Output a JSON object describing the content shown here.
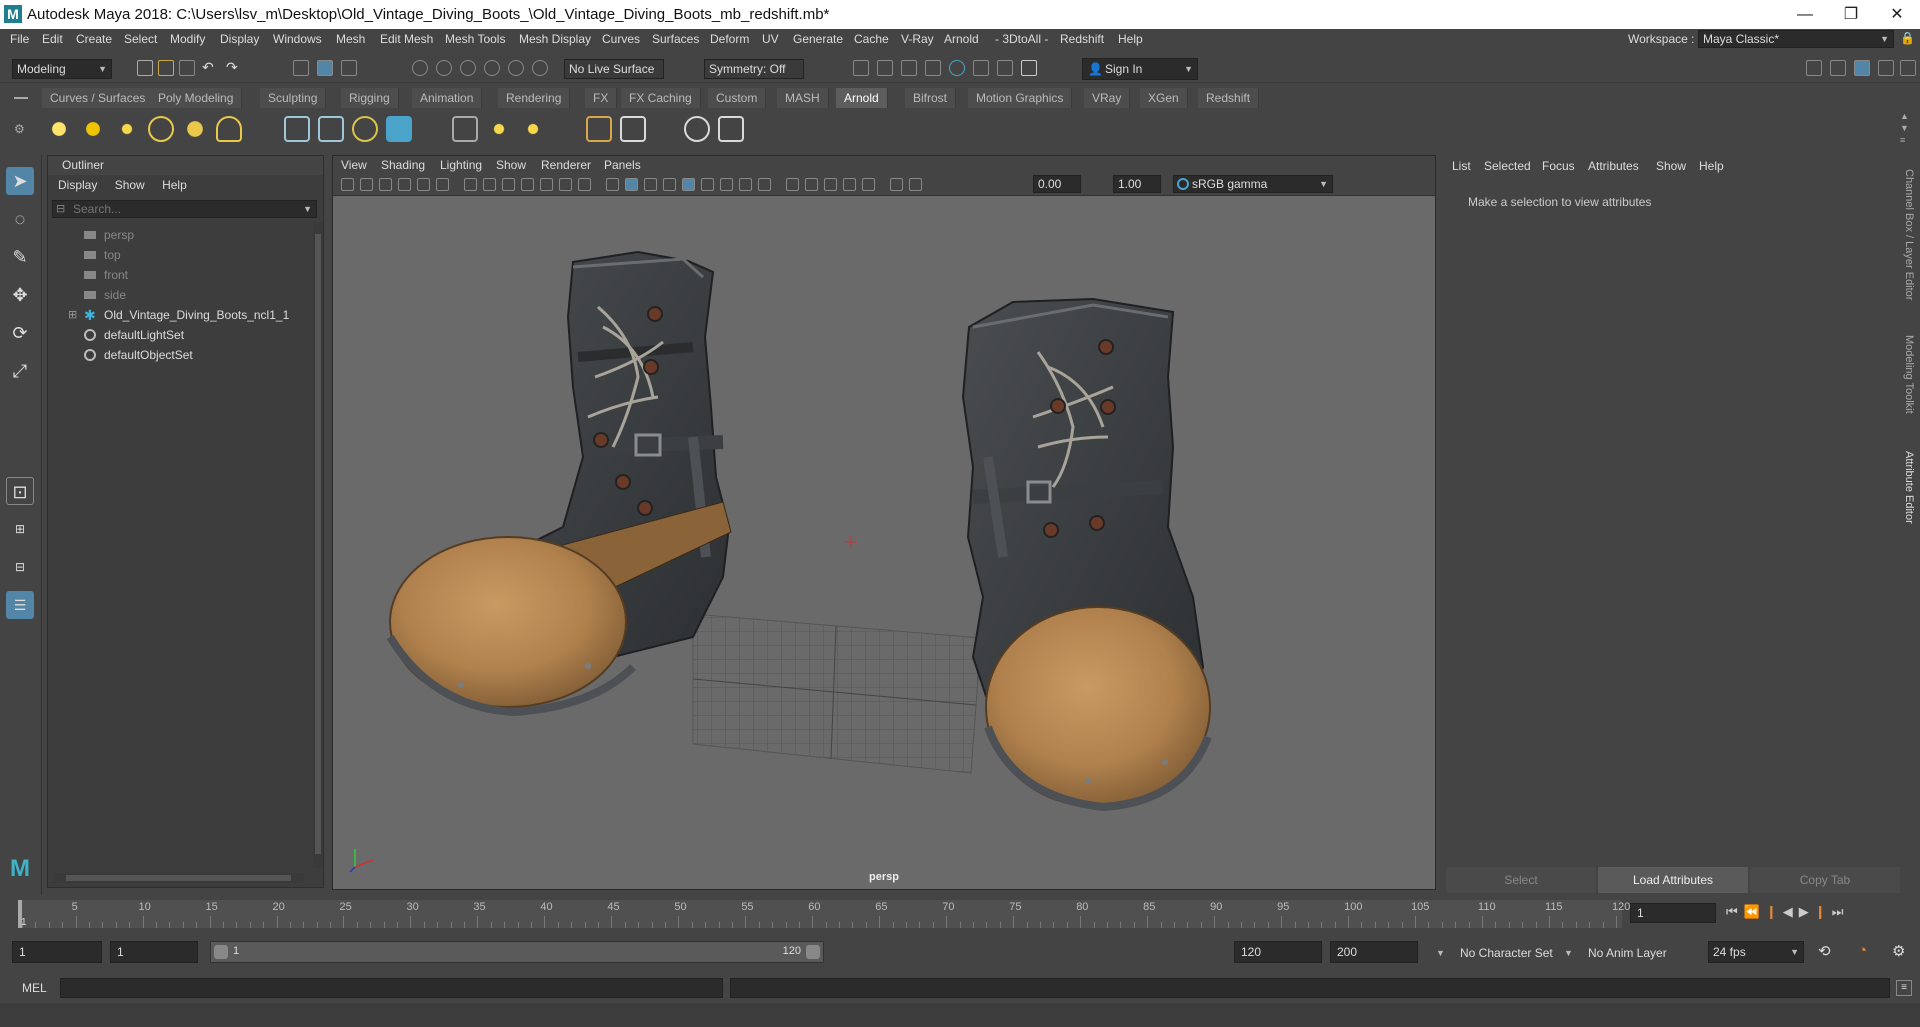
{
  "window": {
    "title": "Autodesk Maya 2018: C:\\Users\\lsv_m\\Desktop\\Old_Vintage_Diving_Boots_\\Old_Vintage_Diving_Boots_mb_redshift.mb*",
    "logo": "M",
    "minimize_icon": "—",
    "maximize_icon": "❐",
    "close_icon": "✕"
  },
  "menubar": [
    "File",
    "Edit",
    "Create",
    "Select",
    "Modify",
    "Display",
    "Windows",
    "Mesh",
    "Edit Mesh",
    "Mesh Tools",
    "Mesh Display",
    "Curves",
    "Surfaces",
    "Deform",
    "UV",
    "Generate",
    "Cache",
    "V-Ray",
    "Arnold",
    "- 3DtoAll -",
    "Redshift",
    "Help"
  ],
  "workspace": {
    "label": "Workspace :",
    "value": "Maya Classic*"
  },
  "statusline": {
    "mode": "Modeling",
    "live_surface": "No Live Surface",
    "symmetry": "Symmetry: Off",
    "sign_in": "Sign In"
  },
  "shelf_tabs": [
    "Curves / Surfaces",
    "Poly Modeling",
    "Sculpting",
    "Rigging",
    "Animation",
    "Rendering",
    "FX",
    "FX Caching",
    "Custom",
    "MASH",
    "Arnold",
    "Bifrost",
    "Motion Graphics",
    "VRay",
    "XGen",
    "Redshift"
  ],
  "active_shelf_tab": "Arnold",
  "outliner": {
    "title": "Outliner",
    "menu": [
      "Display",
      "Show",
      "Help"
    ],
    "search_placeholder": "Search...",
    "items": [
      {
        "label": "persp",
        "type": "camera",
        "dim": true
      },
      {
        "label": "top",
        "type": "camera",
        "dim": true
      },
      {
        "label": "front",
        "type": "camera",
        "dim": true
      },
      {
        "label": "side",
        "type": "camera",
        "dim": true
      },
      {
        "label": "Old_Vintage_Diving_Boots_ncl1_1",
        "type": "group",
        "dim": false
      },
      {
        "label": "defaultLightSet",
        "type": "set",
        "dim": false
      },
      {
        "label": "defaultObjectSet",
        "type": "set",
        "dim": false
      }
    ]
  },
  "viewport": {
    "menu": [
      "View",
      "Shading",
      "Lighting",
      "Show",
      "Renderer",
      "Panels"
    ],
    "near_value": "0.00",
    "far_value": "1.00",
    "color_space": "sRGB gamma",
    "camera_label": "persp"
  },
  "attribute_editor": {
    "menu": [
      "List",
      "Selected",
      "Focus",
      "Attributes",
      "Show",
      "Help"
    ],
    "message": "Make a selection to view attributes",
    "buttons": [
      "Select",
      "Load Attributes",
      "Copy Tab"
    ]
  },
  "side_tabs": [
    "Channel Box / Layer Editor",
    "Modeling Toolkit",
    "Attribute Editor"
  ],
  "timeline": {
    "ticks": [
      5,
      10,
      15,
      20,
      25,
      30,
      35,
      40,
      45,
      50,
      55,
      60,
      65,
      70,
      75,
      80,
      85,
      90,
      95,
      100,
      105,
      110,
      115,
      120
    ],
    "current_frame": "1",
    "start_marker": "1"
  },
  "range": {
    "start": "1",
    "playback_start": "1",
    "slider_start": "1",
    "slider_end": "120",
    "playback_end": "120",
    "end": "200",
    "character_set": "No Character Set",
    "anim_layer": "No Anim Layer",
    "fps": "24 fps"
  },
  "command_line": {
    "language": "MEL"
  },
  "colors": {
    "accent": "#5285a6",
    "boot_leather": "#3a3d40",
    "toe_cap": "#b88a55"
  }
}
